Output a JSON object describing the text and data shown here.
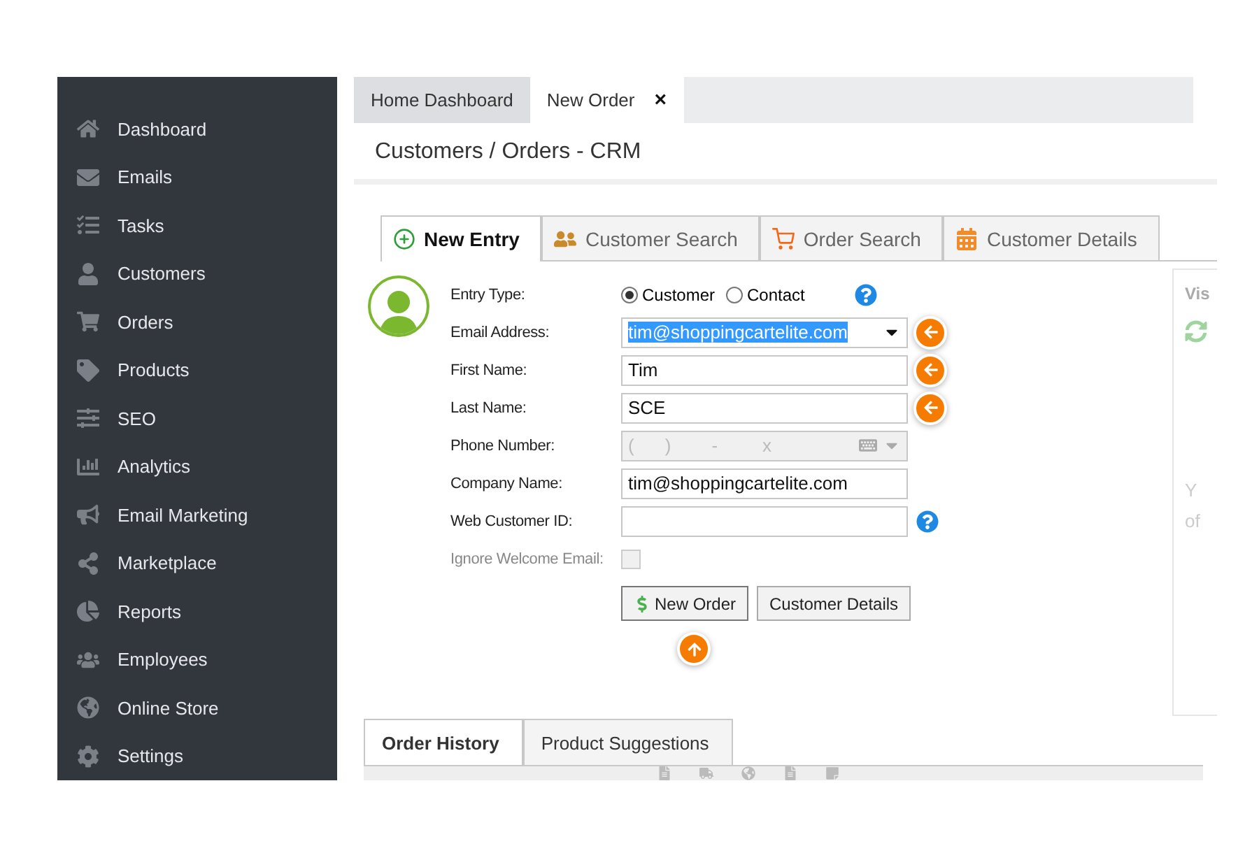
{
  "sidebar": {
    "items": [
      {
        "label": "Dashboard"
      },
      {
        "label": "Emails"
      },
      {
        "label": "Tasks"
      },
      {
        "label": "Customers"
      },
      {
        "label": "Orders"
      },
      {
        "label": "Products"
      },
      {
        "label": "SEO"
      },
      {
        "label": "Analytics"
      },
      {
        "label": "Email Marketing"
      },
      {
        "label": "Marketplace"
      },
      {
        "label": "Reports"
      },
      {
        "label": "Employees"
      },
      {
        "label": "Online Store"
      },
      {
        "label": "Settings"
      }
    ]
  },
  "tabs": [
    {
      "label": "Home Dashboard",
      "selected": false
    },
    {
      "label": "New Order",
      "selected": true,
      "close": "×"
    }
  ],
  "page_title": "Customers / Orders - CRM",
  "entry_tabs": [
    {
      "label": "New Entry",
      "selected": true
    },
    {
      "label": "Customer Search",
      "selected": false
    },
    {
      "label": "Order Search",
      "selected": false
    },
    {
      "label": "Customer Details",
      "selected": false
    }
  ],
  "form": {
    "rows": [
      {
        "kind": "radio",
        "label": "Entry Type:",
        "options": [
          {
            "label": "Customer",
            "selected": true
          },
          {
            "label": "Contact",
            "selected": false
          }
        ],
        "help": true
      },
      {
        "kind": "select",
        "label": "Email Address:",
        "value": "tim@shoppingcartelite.com",
        "highlighted": true,
        "copy": true
      },
      {
        "kind": "text",
        "label": "First Name:",
        "value": "Tim",
        "copy": true
      },
      {
        "kind": "text",
        "label": "Last Name:",
        "value": "SCE",
        "copy": true
      },
      {
        "kind": "phone",
        "label": "Phone Number:",
        "mask": [
          "(",
          ")",
          "-",
          "x"
        ],
        "disabled": true
      },
      {
        "kind": "text",
        "label": "Company Name:",
        "value": "tim@shoppingcartelite.com"
      },
      {
        "kind": "text",
        "label": "Web Customer ID:",
        "help": true
      },
      {
        "kind": "checkbox",
        "label": "Ignore Welcome Email:",
        "checked": false,
        "disabled": true
      }
    ],
    "buttons": [
      {
        "label": "New Order",
        "primary": true,
        "pointer": true
      },
      {
        "label": "Customer Details",
        "primary": false,
        "pointer": false
      }
    ]
  },
  "side_panel": {
    "title": "Vis",
    "lines": [
      "Y",
      "of"
    ]
  },
  "history_tabs": [
    {
      "label": "Order History",
      "selected": true
    },
    {
      "label": "Product Suggestions",
      "selected": false
    }
  ]
}
